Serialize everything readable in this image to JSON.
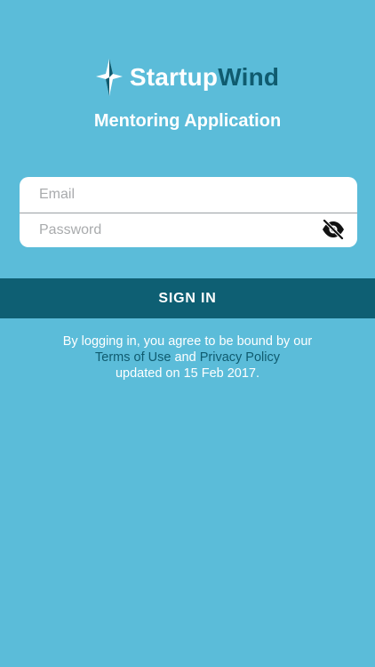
{
  "brand": {
    "name_part1": "Startup",
    "name_part2": "Wind",
    "logo_icon": "compass-star-icon"
  },
  "app_title": "Mentoring Application",
  "login_form": {
    "email_placeholder": "Email",
    "password_placeholder": "Password",
    "password_toggle_icon": "eye-slash-icon"
  },
  "sign_in_label": "SIGN IN",
  "legal": {
    "line1": "By logging in, you agree to be bound by our",
    "terms_link": "Terms of Use",
    "and_text": " and",
    "privacy_link": "Privacy Policy",
    "line3": "updated on 15 Feb 2017."
  },
  "colors": {
    "background": "#5bbcd9",
    "accent_dark": "#0e5f73",
    "link": "#0f5b6f",
    "white": "#ffffff"
  }
}
